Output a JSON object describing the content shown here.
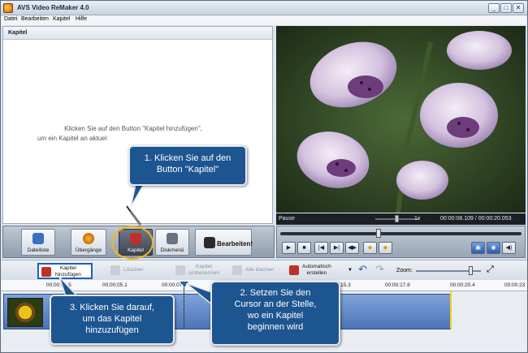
{
  "window": {
    "title": "AVS Video ReMaker 4.0",
    "min_label": "_",
    "max_label": "□",
    "close_label": "✕"
  },
  "menu": [
    "Datei",
    "Bearbeiten",
    "Kapitel",
    "Hilfe"
  ],
  "left_panel": {
    "title": "Kapitel",
    "hint_line1": "Klicken Sie auf den Button \"Kapitel hinzufügen\",",
    "hint_line2": "um ein Kapitel an aktuel"
  },
  "preview": {
    "status": "Pause",
    "speed": "1x",
    "time": "00:00:08.109 / 00:00:20.053"
  },
  "toolbar": {
    "buttons": [
      {
        "label": "Dateiliste",
        "icon": "file-list-icon"
      },
      {
        "label": "Übergänge",
        "icon": "transitions-icon"
      },
      {
        "label": "Kapitel",
        "icon": "chapter-icon"
      },
      {
        "label": "Diskmenü",
        "icon": "disc-menu-icon"
      }
    ],
    "remake_label": "Bearbeiten!"
  },
  "playback": {
    "seek_fraction": 0.4,
    "buttons": [
      "▶",
      "■",
      "|◀",
      "▶|",
      "◀▶",
      "◆",
      "◆"
    ],
    "right_buttons": [
      "▣",
      "◉",
      "◀)"
    ]
  },
  "chapter_toolbar": {
    "add_label_1": "Kapitel",
    "add_label_2": "hinzufügen",
    "delete_label": "Löschen",
    "rename_label_1": "Kapitel",
    "rename_label_2": "umbenennen",
    "delete_all_label": "Alle löschen",
    "auto_label_1": "Automatisch",
    "auto_label_2": "erstellen",
    "undo_label": "↶",
    "redo_label": "↷",
    "zoom_label": "Zoom:",
    "fit_label": "⤢"
  },
  "timeline": {
    "ticks": [
      "00:00:02.5",
      "00:00:05.1",
      "00:00:07",
      "00:00:15.3",
      "00:00:17.8",
      "00:00:20.4",
      "00:00:23"
    ]
  },
  "callouts": {
    "c1_line1": "1. Klicken Sie auf den",
    "c1_line2": "Button \"Kapitel\"",
    "c2_line1": "2. Setzen Sie den",
    "c2_line2": "Cursor an der Stelle,",
    "c2_line3": "wo ein Kapitel",
    "c2_line4": "beginnen wird",
    "c3_line1": "3. Klicken Sie darauf,",
    "c3_line2": "um das Kapitel",
    "c3_line3": "hinzuzufügen"
  },
  "colors": {
    "accent": "#1d5590",
    "highlight": "#f2b51b",
    "clip": "#4c74b8"
  }
}
